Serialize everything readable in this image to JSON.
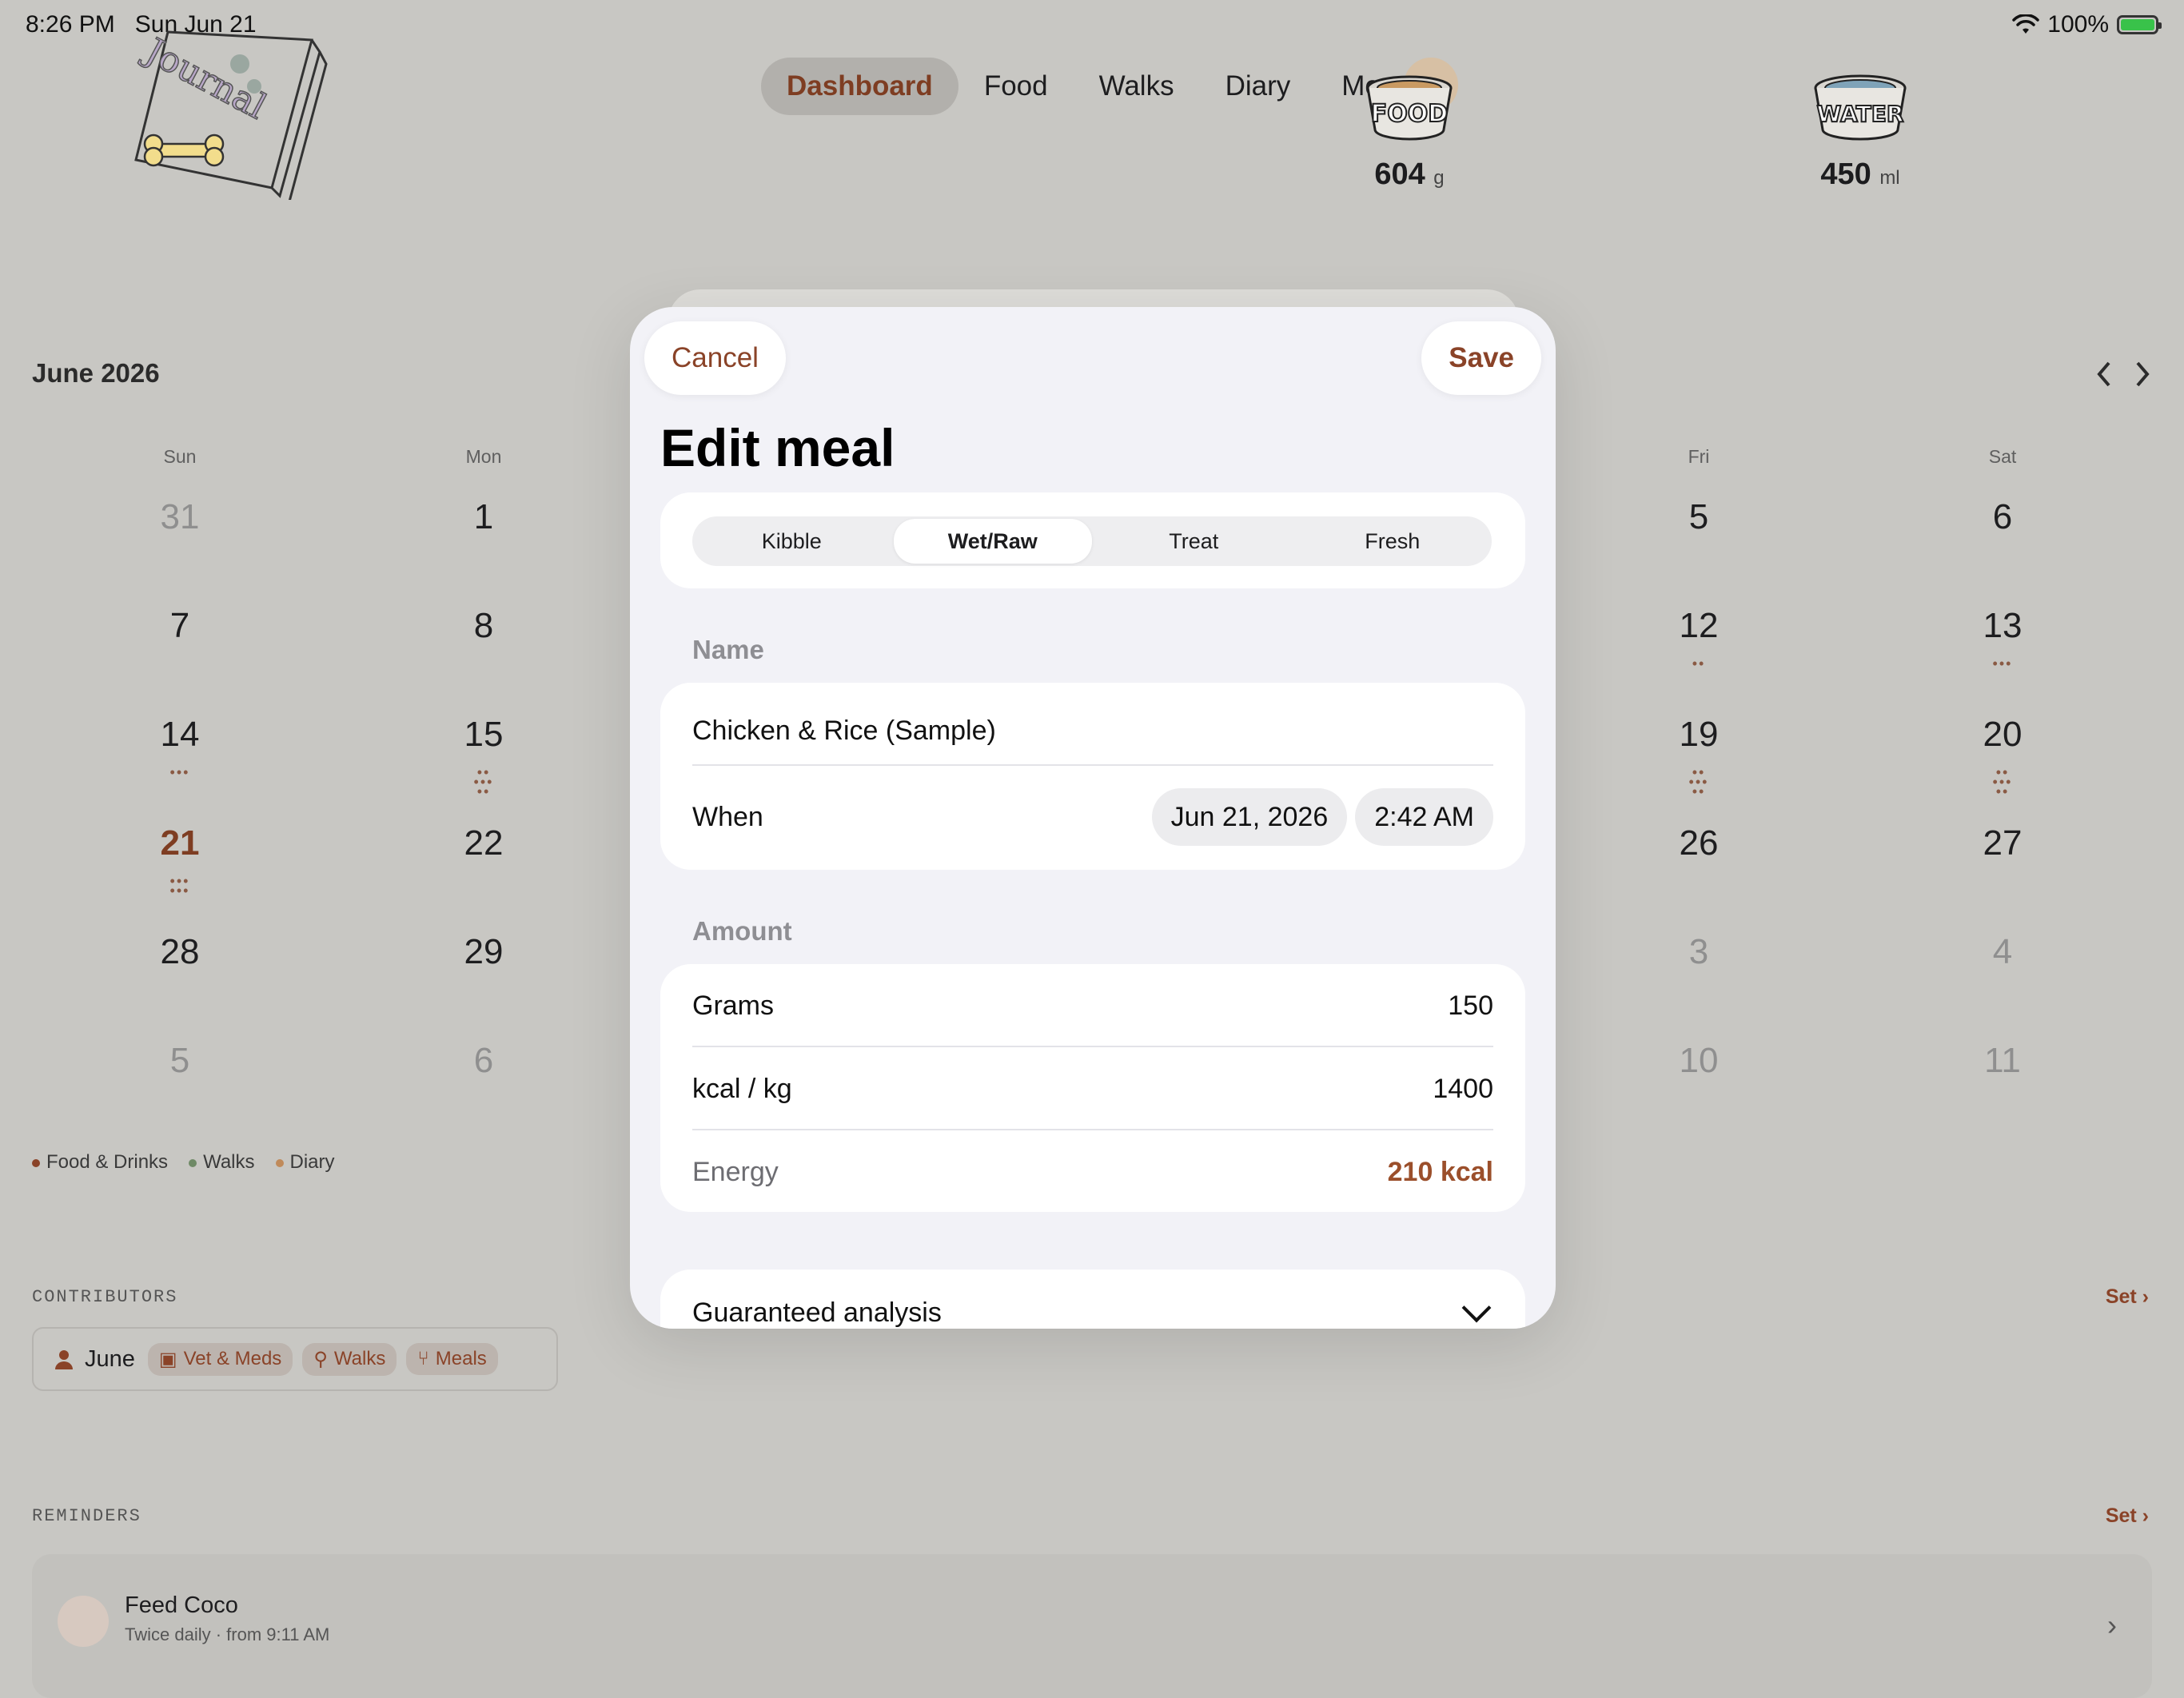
{
  "status": {
    "time": "8:26 PM",
    "date": "Sun Jun 21",
    "battery": "100%"
  },
  "nav": {
    "items": [
      "Dashboard",
      "Food",
      "Walks",
      "Diary",
      "More"
    ],
    "active_index": 0
  },
  "logo": {
    "text": "Journal"
  },
  "bowls": [
    {
      "label": "FOOD",
      "value": "604",
      "unit": "g"
    },
    {
      "label": "WATER",
      "value": "450",
      "unit": "ml"
    }
  ],
  "calendar": {
    "month": "June 2026",
    "weekdays_visible": [
      {
        "label": "Sun",
        "col": 0
      },
      {
        "label": "Mon",
        "col": 1
      },
      {
        "label": "Fri",
        "col": 5
      },
      {
        "label": "Sat",
        "col": 6
      }
    ],
    "weeks": [
      [
        {
          "d": "31",
          "m": true
        },
        {
          "d": "1"
        },
        null,
        null,
        null,
        {
          "d": "5"
        },
        {
          "d": "6"
        }
      ],
      [
        {
          "d": "7"
        },
        {
          "d": "8"
        },
        null,
        null,
        null,
        {
          "d": "12",
          "dots": "••"
        },
        {
          "d": "13",
          "dots": "•••"
        }
      ],
      [
        {
          "d": "14",
          "dots": "•••"
        },
        {
          "d": "15",
          "dots": "••|•••|••"
        },
        null,
        null,
        null,
        {
          "d": "19",
          "dots": "••|•••|••"
        },
        {
          "d": "20",
          "dots": "••|•••|••"
        }
      ],
      [
        {
          "d": "21",
          "t": true,
          "dots": "•••|•••"
        },
        {
          "d": "22"
        },
        null,
        null,
        null,
        {
          "d": "26"
        },
        {
          "d": "27"
        }
      ],
      [
        {
          "d": "28"
        },
        {
          "d": "29"
        },
        null,
        null,
        null,
        {
          "d": "3",
          "m": true
        },
        {
          "d": "4",
          "m": true
        }
      ],
      [
        {
          "d": "5",
          "m": true
        },
        {
          "d": "6",
          "m": true
        },
        null,
        null,
        null,
        {
          "d": "10",
          "m": true
        },
        {
          "d": "11",
          "m": true
        }
      ]
    ],
    "legend": [
      {
        "label": "Food & Drinks",
        "color": "#8a4328"
      },
      {
        "label": "Walks",
        "color": "#6f8a66"
      },
      {
        "label": "Diary",
        "color": "#c08a5a"
      }
    ]
  },
  "contributors": {
    "label": "CONTRIBUTORS",
    "set": "Set",
    "name": "June",
    "chips": [
      "Vet & Meds",
      "Walks",
      "Meals"
    ]
  },
  "reminders": {
    "label": "REMINDERS",
    "set": "Set",
    "item_title": "Feed Coco",
    "item_sub": "Twice daily · from 9:11 AM"
  },
  "modal": {
    "cancel": "Cancel",
    "save": "Save",
    "title": "Edit meal",
    "segments": [
      "Kibble",
      "Wet/Raw",
      "Treat",
      "Fresh"
    ],
    "selected_segment": 1,
    "name_label": "Name",
    "name_value": "Chicken & Rice (Sample)",
    "when_label": "When",
    "when_date": "Jun 21, 2026",
    "when_time": "2:42 AM",
    "amount_label": "Amount",
    "grams_label": "Grams",
    "grams_value": "150",
    "kcal_label": "kcal / kg",
    "kcal_value": "1400",
    "energy_label": "Energy",
    "energy_value": "210 kcal",
    "analysis_label": "Guaranteed analysis"
  },
  "colors": {
    "accent": "#8a4328",
    "background": "#c8c7c3",
    "sheet": "#f2f2f7"
  }
}
